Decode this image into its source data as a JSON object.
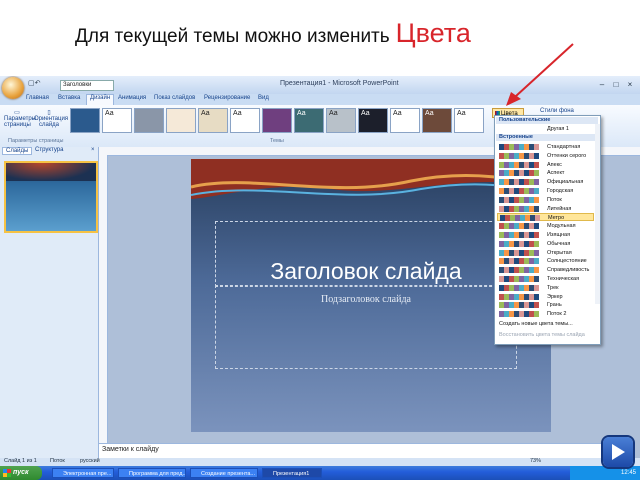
{
  "heading": {
    "text": "Для текущей темы можно изменить",
    "accent": "Цвета"
  },
  "app": {
    "title": "Презентация1 - Microsoft PowerPoint",
    "font_combo": "Заголовки",
    "tabs": [
      "Главная",
      "Вставка",
      "Дизайн",
      "Анимация",
      "Показ слайдов",
      "Рецензирование",
      "Вид"
    ],
    "active_tab": "Дизайн",
    "ribbon": {
      "page_setup": "Параметры страницы",
      "orientation": "Ориентация слайда",
      "page_setup_group": "Параметры страницы",
      "themes_group": "Темы",
      "colors_button": "Цвета",
      "fonts_button": "Стили фона",
      "theme_sample": "Аа"
    },
    "pane_tabs": [
      "Слайды",
      "Структура"
    ],
    "slide": {
      "title": "Заголовок слайда",
      "subtitle": "Подзаголовок слайда"
    },
    "notes": "Заметки к слайду",
    "status": {
      "slide_info": "Слайд 1 из 1",
      "theme": "Поток",
      "lang": "русский",
      "zoom": "73%"
    },
    "taskbar": {
      "start": "пуск",
      "items": [
        "Электронная пре...",
        "Программа для пред...",
        "Создание презента...",
        "Презентация1"
      ],
      "clock": "12:45"
    },
    "colors_menu": {
      "header_custom": "Пользовательские",
      "custom_item": "Другая 1",
      "header_builtin": "Встроенные",
      "items": [
        "Стандартная",
        "Оттенки серого",
        "Апекс",
        "Аспект",
        "Официальная",
        "Городская",
        "Поток",
        "Литейная",
        "Метро",
        "Модульная",
        "Изящная",
        "Обычная",
        "Открытая",
        "Солнцестояние",
        "Справедливость",
        "Техническая",
        "Трек",
        "Эркер",
        "Грань",
        "Поток 2"
      ],
      "highlighted": "Метро",
      "footer_create": "Создать новые цвета темы...",
      "footer_reset": "Восстановить цвета темы слайда"
    },
    "colors": {
      "accent_red": "#d8252b",
      "ribbon_blue": "#15428b",
      "highlight": "#ffe69a"
    }
  }
}
